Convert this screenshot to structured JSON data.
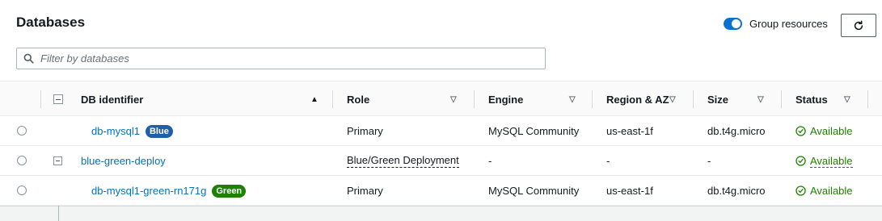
{
  "header": {
    "title": "Databases",
    "group_toggle_label": "Group resources",
    "group_toggle_on": true
  },
  "search": {
    "placeholder": "Filter by databases"
  },
  "table": {
    "columns": {
      "db_identifier": "DB identifier",
      "role": "Role",
      "engine": "Engine",
      "region": "Region & AZ",
      "size": "Size",
      "status": "Status"
    },
    "rows": [
      {
        "identifier": "db-mysql1",
        "badge": "Blue",
        "role": "Primary",
        "engine": "MySQL Community",
        "region": "us-east-1f",
        "size": "db.t4g.micro",
        "status": "Available"
      },
      {
        "identifier": "blue-green-deploy",
        "badge": "",
        "role": "Blue/Green Deployment",
        "engine": "-",
        "region": "-",
        "size": "-",
        "status": "Available"
      },
      {
        "identifier": "db-mysql1-green-rn171g",
        "badge": "Green",
        "role": "Primary",
        "engine": "MySQL Community",
        "region": "us-east-1f",
        "size": "db.t4g.micro",
        "status": "Available"
      }
    ]
  },
  "colors": {
    "link": "#0073bb",
    "badge_blue": "#1f5fa8",
    "badge_green": "#1d8102",
    "status_available": "#1d8102",
    "toggle_on": "#0972d3"
  },
  "icons": {
    "search": "search-icon",
    "refresh": "refresh-icon",
    "status_ok": "check-circle-icon",
    "sort_asc": "caret-up-icon",
    "sort_none": "caret-down-outline-icon"
  }
}
